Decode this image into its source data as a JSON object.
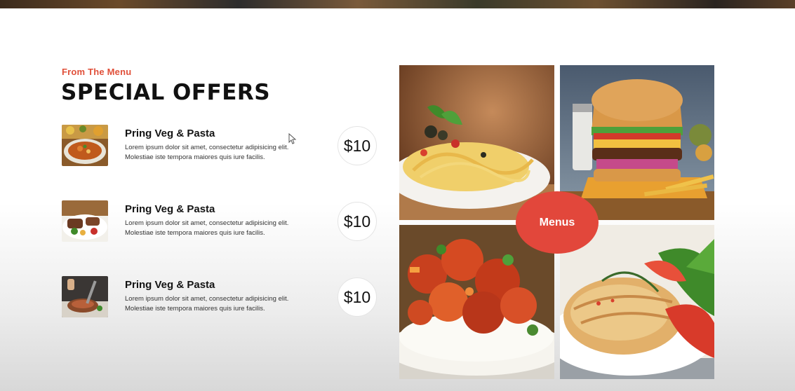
{
  "section": {
    "eyebrow": "From The Menu",
    "title": "SPECIAL OFFERS"
  },
  "offers": [
    {
      "name": "Pring Veg & Pasta",
      "desc_line1": "Lorem ipsum dolor sit amet, consectetur adipisicing elit.",
      "desc_line2": "Molestiae iste tempora maiores quis iure facilis.",
      "price": "$10",
      "image": "curry-bowl"
    },
    {
      "name": "Pring Veg & Pasta",
      "desc_line1": "Lorem ipsum dolor sit amet, consectetur adipisicing elit.",
      "desc_line2": "Molestiae iste tempora maiores quis iure facilis.",
      "price": "$10",
      "image": "grilled-meat-vegetables"
    },
    {
      "name": "Pring Veg & Pasta",
      "desc_line1": "Lorem ipsum dolor sit amet, consectetur adipisicing elit.",
      "desc_line2": "Molestiae iste tempora maiores quis iure facilis.",
      "price": "$10",
      "image": "steak-cutting"
    }
  ],
  "gallery": [
    {
      "image": "pasta-plate"
    },
    {
      "image": "burger-fries"
    },
    {
      "image": "sweet-sour-chicken-rice"
    },
    {
      "image": "grilled-chicken-salad"
    }
  ],
  "menus_button": {
    "label": "Menus"
  },
  "colors": {
    "accent": "#e2473b",
    "eyebrow": "#e0503a",
    "text": "#111111"
  }
}
